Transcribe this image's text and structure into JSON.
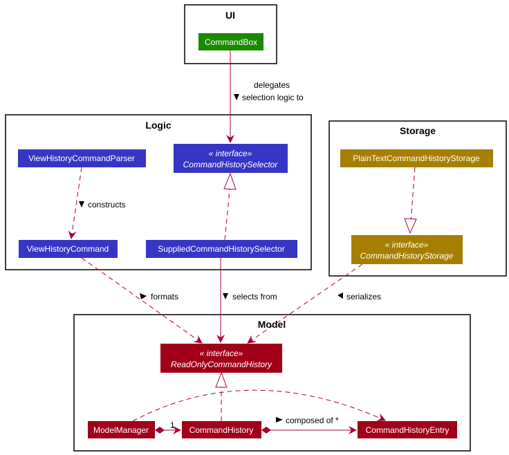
{
  "colors": {
    "ui": "#1a8a00",
    "logic": "#3636c4",
    "storage": "#a67f00",
    "model": "#a00018",
    "edge": "#a80036"
  },
  "packages": {
    "ui": "UI",
    "logic": "Logic",
    "storage": "Storage",
    "model": "Model"
  },
  "classes": {
    "command_box": "CommandBox",
    "view_history_command_parser": "ViewHistoryCommandParser",
    "command_history_selector": {
      "stereotype": "« interface»",
      "name": "CommandHistorySelector"
    },
    "view_history_command": "ViewHistoryCommand",
    "supplied_command_history_selector": "SuppliedCommandHistorySelector",
    "plain_text_command_history_storage": "PlainTextCommandHistoryStorage",
    "command_history_storage": {
      "stereotype": "« interface»",
      "name": "CommandHistoryStorage"
    },
    "read_only_command_history": {
      "stereotype": "« interface»",
      "name": "ReadOnlyCommandHistory"
    },
    "model_manager": "ModelManager",
    "command_history": "CommandHistory",
    "command_history_entry": "CommandHistoryEntry"
  },
  "labels": {
    "delegates_line1": "delegates",
    "delegates_line2": "selection logic to",
    "constructs": "constructs",
    "formats": "formats",
    "selects_from": "selects from",
    "serializes": "serializes",
    "composed_of": "composed of *",
    "multiplicity_one": "1"
  }
}
